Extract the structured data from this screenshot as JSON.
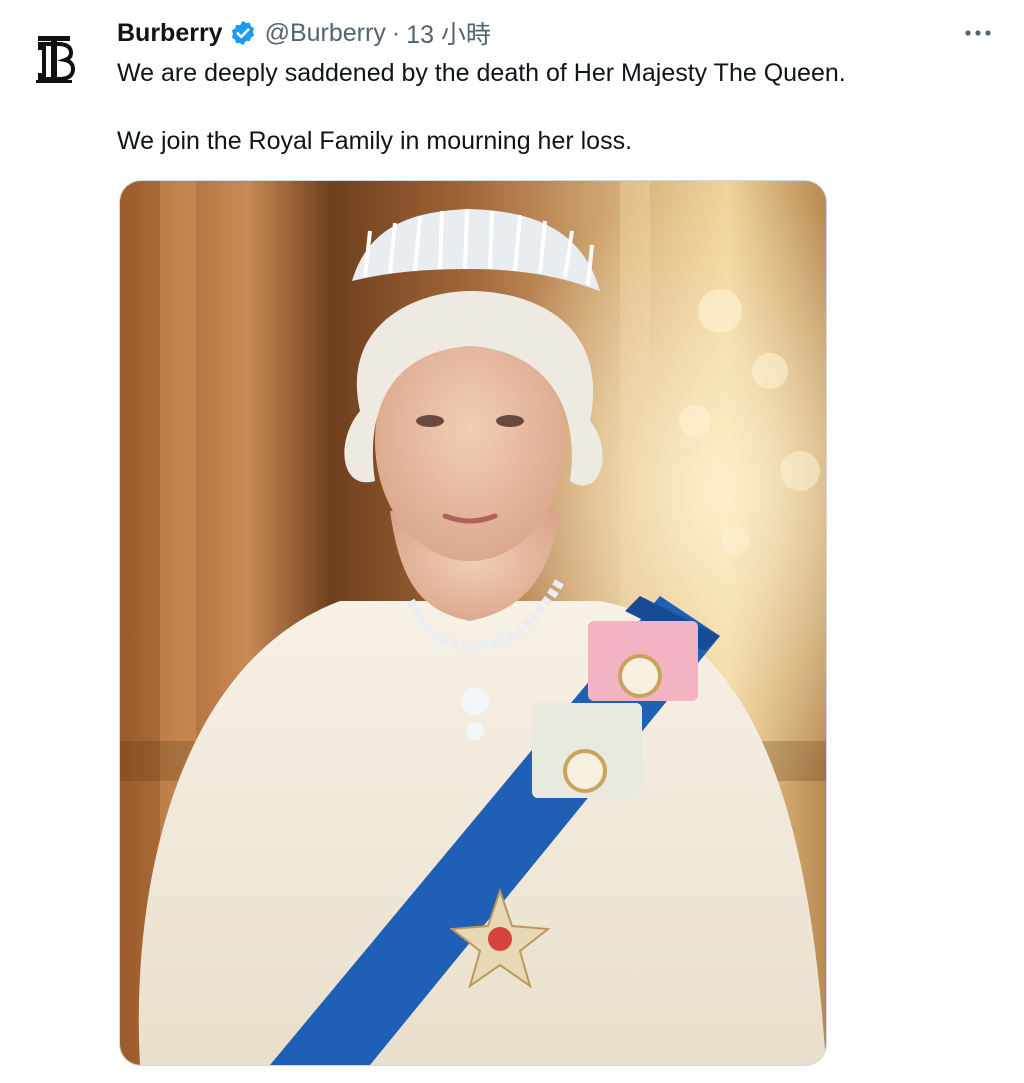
{
  "tweet": {
    "author": {
      "display_name": "Burberry",
      "handle": "@Burberry",
      "avatar_icon": "burberry-tb-monogram",
      "verified_icon": "verified-badge-icon",
      "verified_color": "#1d9bf0"
    },
    "separator": "·",
    "timestamp": "13 小時",
    "more_icon": "more-horizontal-icon",
    "text_lines": [
      "We are deeply saddened by the death of Her Majesty The Queen.",
      "We join the Royal Family in mourning her loss."
    ],
    "media": {
      "type": "photo",
      "accent_color": "#1f5fb5"
    }
  }
}
